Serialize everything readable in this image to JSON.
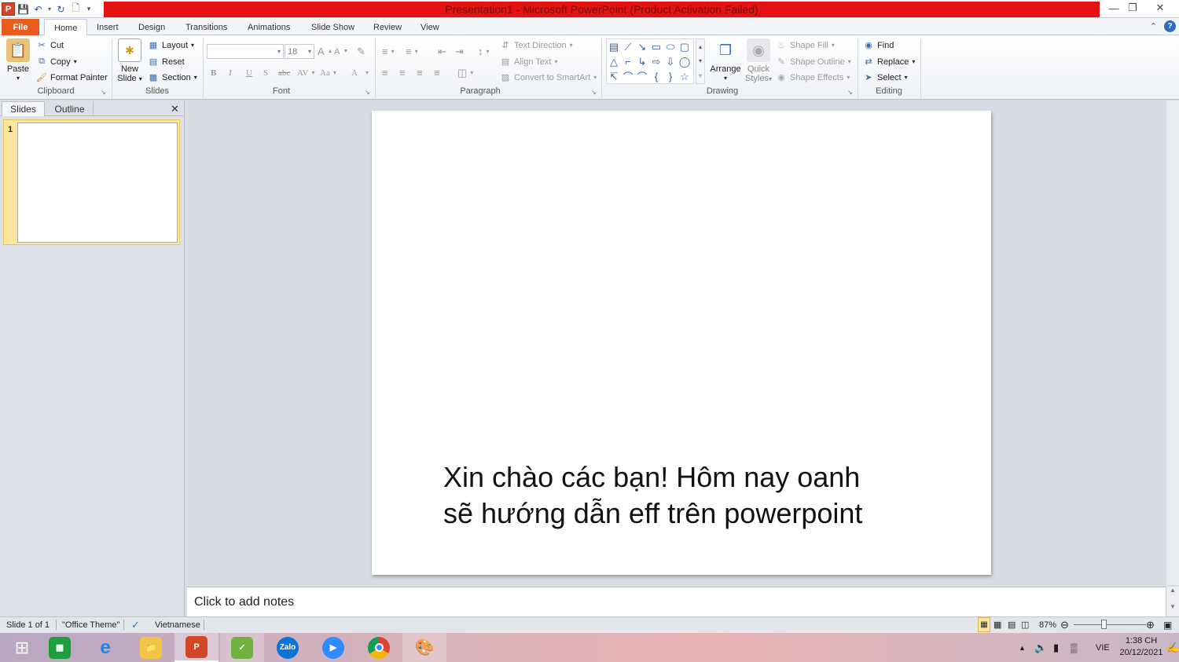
{
  "window": {
    "title": "Presentation1  -  Microsoft PowerPoint (Product Activation Failed)"
  },
  "tabs": [
    "File",
    "Home",
    "Insert",
    "Design",
    "Transitions",
    "Animations",
    "Slide Show",
    "Review",
    "View"
  ],
  "clipboard": {
    "paste": "Paste",
    "cut": "Cut",
    "copy": "Copy",
    "format_painter": "Format Painter",
    "label": "Clipboard"
  },
  "slides_group": {
    "new_slide_1": "New",
    "new_slide_2": "Slide",
    "layout": "Layout",
    "reset": "Reset",
    "section": "Section",
    "label": "Slides"
  },
  "font": {
    "font_name": "",
    "font_size": "18",
    "label": "Font"
  },
  "paragraph": {
    "text_direction": "Text Direction",
    "align_text": "Align Text",
    "convert_smartart": "Convert to SmartArt",
    "label": "Paragraph"
  },
  "drawing": {
    "arrange": "Arrange",
    "quick_styles_1": "Quick",
    "quick_styles_2": "Styles",
    "shape_fill": "Shape Fill",
    "shape_outline": "Shape Outline",
    "shape_effects": "Shape Effects",
    "label": "Drawing"
  },
  "editing": {
    "find": "Find",
    "replace": "Replace",
    "select": "Select",
    "label": "Editing"
  },
  "panel": {
    "tab_slides": "Slides",
    "tab_outline": "Outline",
    "slide_number": "1"
  },
  "slide": {
    "line1": "Xin chào các bạn! Hôm nay oanh",
    "line2": "sẽ hướng dẫn eff trên powerpoint"
  },
  "notes": {
    "placeholder": "Click to add notes"
  },
  "status": {
    "slide_count": "Slide 1 of 1",
    "theme": "\"Office Theme\"",
    "language": "Vietnamese",
    "zoom": "87%"
  },
  "taskbar": {
    "zalo": "Zalo",
    "lang": "VIE",
    "time": "1:38 CH",
    "date": "20/12/2021"
  },
  "colors": {
    "title_bar": "#e31313",
    "file_tab": "#ea5c1e"
  }
}
